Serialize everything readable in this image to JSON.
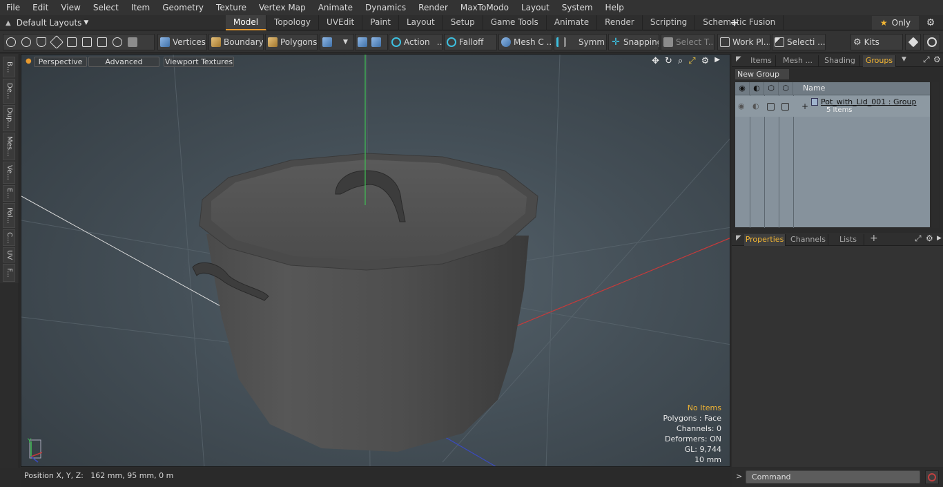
{
  "menu": [
    "File",
    "Edit",
    "View",
    "Select",
    "Item",
    "Geometry",
    "Texture",
    "Vertex Map",
    "Animate",
    "Dynamics",
    "Render",
    "MaxToModo",
    "Layout",
    "System",
    "Help"
  ],
  "layout_selector": "Default Layouts",
  "mode_tabs": [
    "Model",
    "Topology",
    "UVEdit",
    "Paint",
    "Layout",
    "Setup",
    "Game Tools",
    "Animate",
    "Render",
    "Scripting",
    "Schematic Fusion"
  ],
  "active_tab": "Model",
  "only_label": "Only",
  "toolbar": {
    "vertices": "Vertices",
    "boundary": "Boundary",
    "polygons": "Polygons",
    "action": "Action",
    "falloff": "Falloff",
    "mesh": "Mesh C ...",
    "symm": "Symm ...",
    "snapping": "Snapping",
    "select_t": "Select T...",
    "work_pl": "Work Pl...",
    "selecti": "Selecti ...",
    "kits": "Kits"
  },
  "left_tabs": [
    "B...",
    "De...",
    "Dup...",
    "Mes...",
    "Ve...",
    "E...",
    "Pol...",
    "C...",
    "UV",
    "F..."
  ],
  "viewport": {
    "perspective": "Perspective",
    "advanced": "Advanced",
    "textures": "Viewport Textures"
  },
  "info": {
    "no_items": "No Items",
    "polygons": "Polygons : Face",
    "channels": "Channels: 0",
    "deformers": "Deformers: ON",
    "gl": "GL: 9,744",
    "scale": "10 mm"
  },
  "axis_label": "Y",
  "status": "Position X, Y, Z:   162 mm, 95 mm, 0 m",
  "right_tabs": [
    "Items",
    "Mesh ...",
    "Shading",
    "Groups"
  ],
  "active_right_tab": "Groups",
  "new_group": "New Group",
  "group_header": "Name",
  "group_item": {
    "name": "Pot_with_Lid_001 : Group",
    "sub": "5 Items"
  },
  "prop_tabs": [
    "Properties",
    "Channels",
    "Lists"
  ],
  "command_placeholder": "Command"
}
